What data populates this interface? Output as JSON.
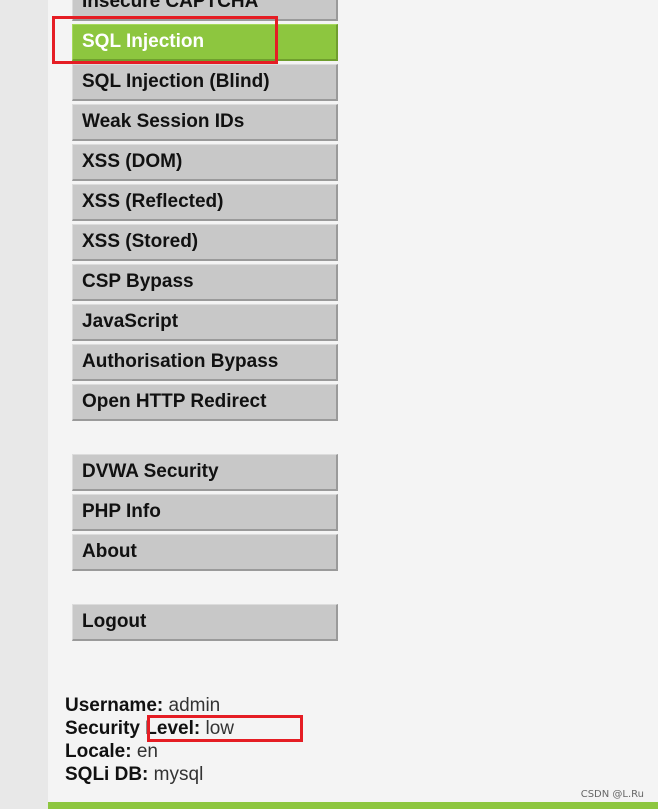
{
  "menu": {
    "group1": [
      {
        "label": "Insecure CAPTCHA",
        "selected": false
      },
      {
        "label": "SQL Injection",
        "selected": true
      },
      {
        "label": "SQL Injection (Blind)",
        "selected": false
      },
      {
        "label": "Weak Session IDs",
        "selected": false
      },
      {
        "label": "XSS (DOM)",
        "selected": false
      },
      {
        "label": "XSS (Reflected)",
        "selected": false
      },
      {
        "label": "XSS (Stored)",
        "selected": false
      },
      {
        "label": "CSP Bypass",
        "selected": false
      },
      {
        "label": "JavaScript",
        "selected": false
      },
      {
        "label": "Authorisation Bypass",
        "selected": false
      },
      {
        "label": "Open HTTP Redirect",
        "selected": false
      }
    ],
    "group2": [
      {
        "label": "DVWA Security"
      },
      {
        "label": "PHP Info"
      },
      {
        "label": "About"
      }
    ],
    "group3": [
      {
        "label": "Logout"
      }
    ]
  },
  "info": {
    "username_label": "Username:",
    "username_value": "admin",
    "security_word": "Security",
    "level_label": "Level:",
    "level_value": "low",
    "locale_label": "Locale:",
    "locale_value": "en",
    "sqli_label": "SQLi DB:",
    "sqli_value": "mysql"
  },
  "watermark": "CSDN @L.Ru",
  "colors": {
    "accent": "#8dc63f",
    "highlight": "#e51d24",
    "button": "#c8c8c8"
  }
}
